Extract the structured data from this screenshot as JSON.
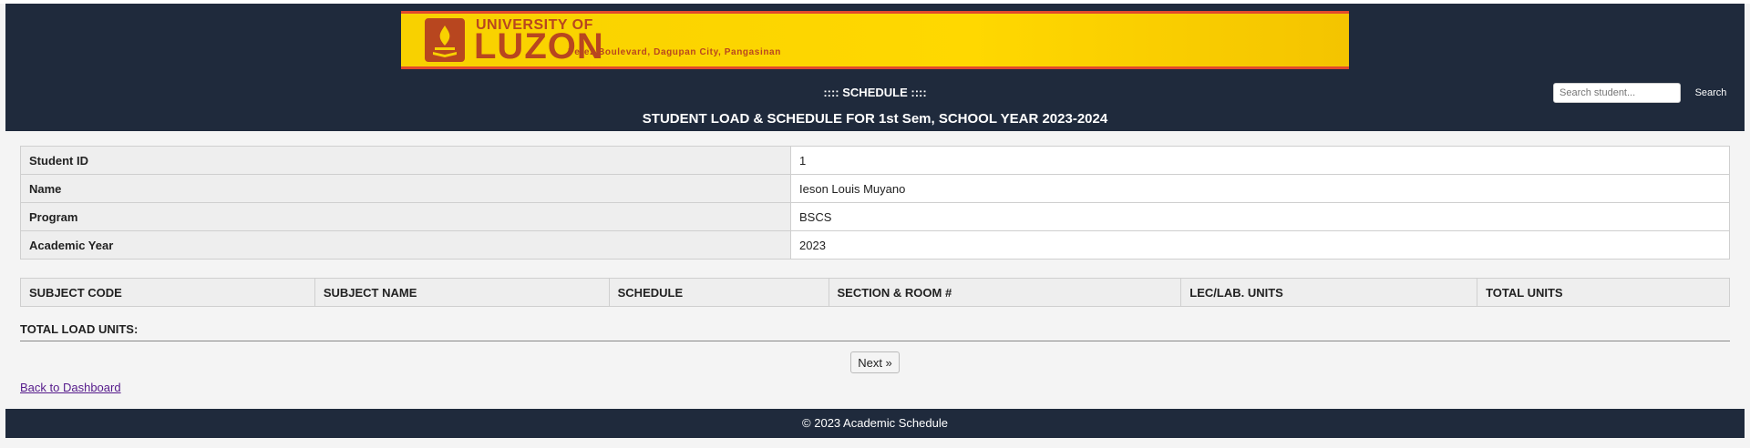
{
  "header": {
    "logo": {
      "top_text": "UNIVERSITY OF",
      "main_text": "LUZON",
      "address": "Perez Boulevard, Dagupan City, Pangasinan"
    },
    "schedule_label": ":::: SCHEDULE ::::",
    "title": "STUDENT LOAD & SCHEDULE FOR 1st Sem, SCHOOL YEAR 2023-2024",
    "search": {
      "placeholder": "Search student...",
      "value": "",
      "button_label": "Search"
    }
  },
  "student_info": [
    {
      "label": "Student ID",
      "value": "1"
    },
    {
      "label": "Name",
      "value": "Ieson Louis Muyano"
    },
    {
      "label": "Program",
      "value": "BSCS"
    },
    {
      "label": "Academic Year",
      "value": "2023"
    }
  ],
  "schedule_table": {
    "columns": [
      "SUBJECT CODE",
      "SUBJECT NAME",
      "SCHEDULE",
      "SECTION & ROOM #",
      "LEC/LAB. UNITS",
      "TOTAL UNITS"
    ],
    "rows": []
  },
  "total_load_label": "TOTAL LOAD UNITS:",
  "next_button_label": "Next »",
  "back_link_label": "Back to Dashboard",
  "footer_text": "© 2023 Academic Schedule",
  "colors": {
    "header_bg": "#1f2a3c",
    "banner_yellow": "#ffd800",
    "brand_red": "#b8461f"
  }
}
